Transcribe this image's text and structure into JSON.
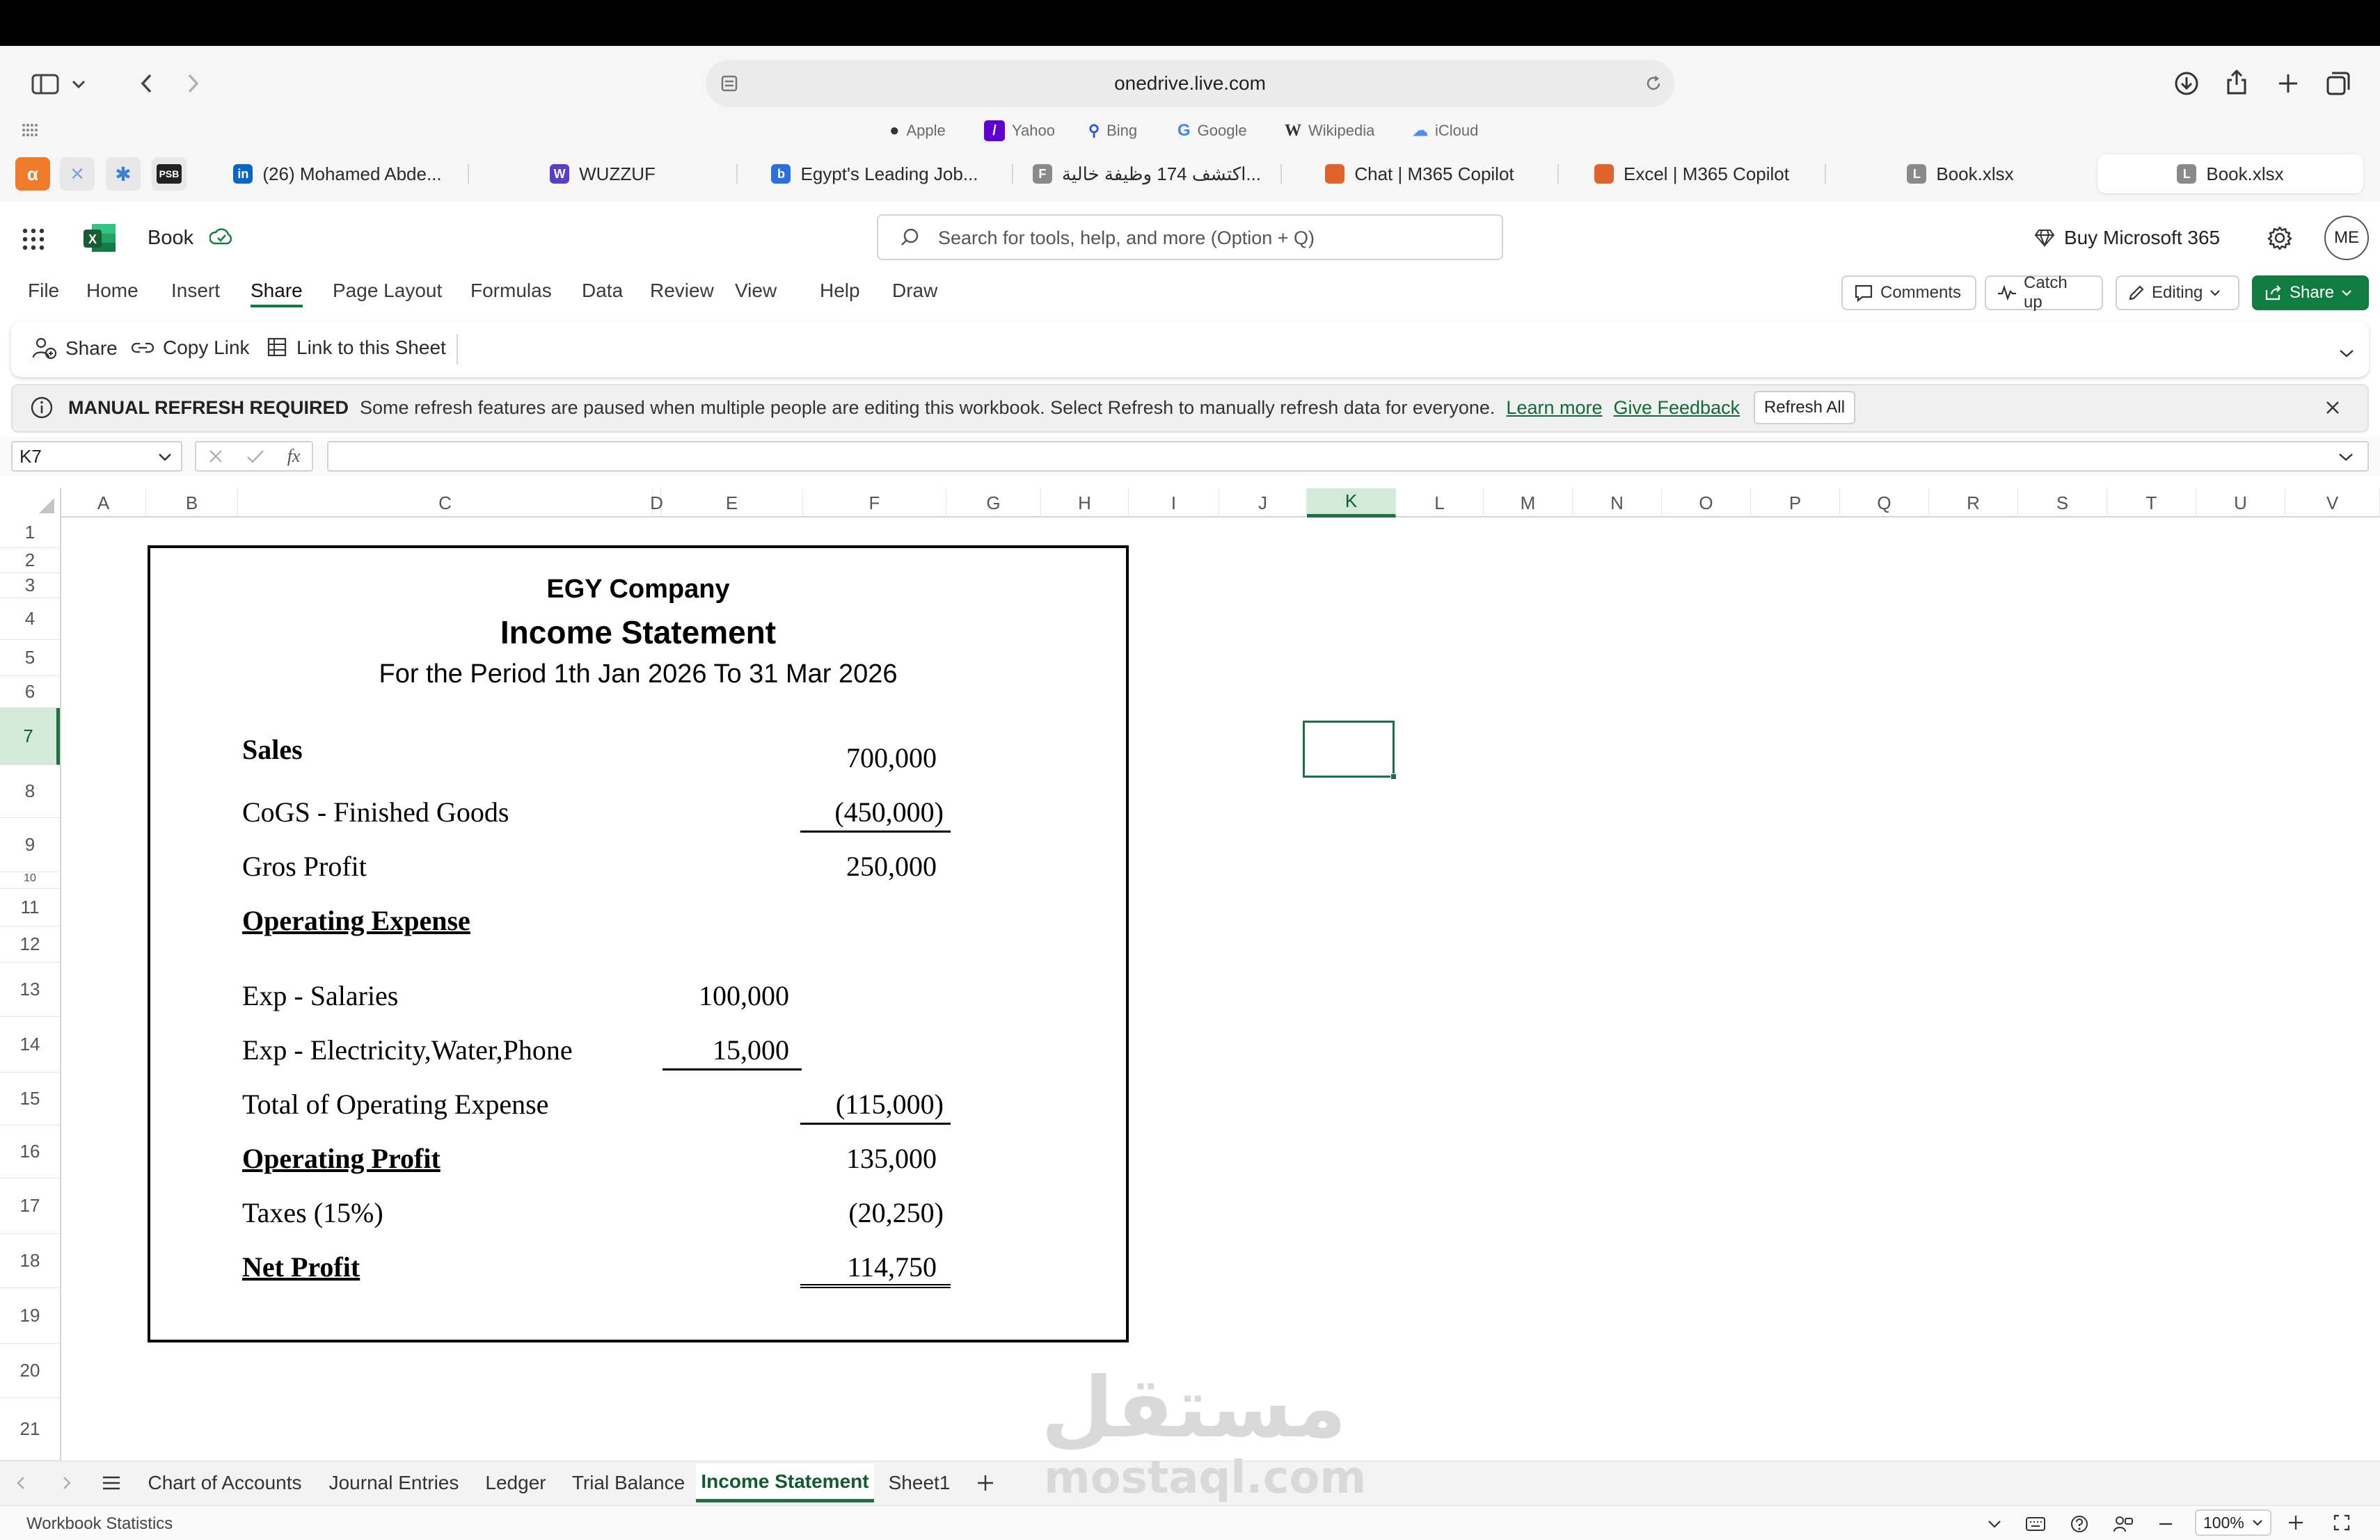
{
  "browser": {
    "address": "onedrive.live.com",
    "favorites": [
      {
        "label": "Apple",
        "icon": "apple-icon"
      },
      {
        "label": "Yahoo",
        "icon": "yahoo-icon"
      },
      {
        "label": "Bing",
        "icon": "bing-icon"
      },
      {
        "label": "Google",
        "icon": "google-icon"
      },
      {
        "label": "Wikipedia",
        "icon": "wikipedia-icon"
      },
      {
        "label": "iCloud",
        "icon": "icloud-icon"
      }
    ],
    "tabs": [
      {
        "label": "(26) Mohamed Abde...",
        "badge": "in",
        "color": "#0a66c2"
      },
      {
        "label": "WUZZUF",
        "badge": "W",
        "color": "#5a3ec8"
      },
      {
        "label": "Egypt's Leading Job...",
        "badge": "b",
        "color": "#2a6fdb"
      },
      {
        "label": "اكتشف 174 وظيفة خالية...",
        "badge": "F",
        "color": "#8a8a8a"
      },
      {
        "label": "Chat | M365 Copilot",
        "badge": "",
        "color": "#e0632b"
      },
      {
        "label": "Excel | M365 Copilot",
        "badge": "",
        "color": "#e0632b"
      },
      {
        "label": "Book.xlsx",
        "badge": "L",
        "color": "#8a8a8a"
      },
      {
        "label": "Book.xlsx",
        "badge": "L",
        "color": "#8a8a8a"
      }
    ]
  },
  "app": {
    "doc_title": "Book",
    "search_placeholder": "Search for tools, help, and more (Option + Q)",
    "buy_label": "Buy Microsoft 365",
    "avatar": "ME",
    "menus": [
      "File",
      "Home",
      "Insert",
      "Share",
      "Page Layout",
      "Formulas",
      "Data",
      "Review",
      "View",
      "Help",
      "Draw"
    ],
    "active_menu": "Share",
    "buttons": {
      "comments": "Comments",
      "catchup": "Catch up",
      "editing": "Editing",
      "share": "Share"
    },
    "ribbon": {
      "share": "Share",
      "copy_link": "Copy Link",
      "link_sheet": "Link to this Sheet"
    },
    "notice": {
      "title": "MANUAL REFRESH REQUIRED",
      "text": "Some refresh features are paused when multiple people are editing this workbook. Select Refresh to manually refresh data for everyone.",
      "learn": "Learn more",
      "feedback": "Give Feedback",
      "refresh": "Refresh All"
    },
    "name_box": "K7",
    "fx": "fx"
  },
  "grid": {
    "columns": [
      "A",
      "B",
      "C",
      "D",
      "E",
      "F",
      "G",
      "H",
      "I",
      "J",
      "K",
      "L",
      "M",
      "N",
      "O",
      "P",
      "Q",
      "R",
      "S",
      "T",
      "U",
      "V"
    ],
    "rows": [
      "1",
      "2",
      "3",
      "4",
      "5",
      "6",
      "7",
      "8",
      "9",
      "10",
      "11",
      "12",
      "13",
      "14",
      "15",
      "16",
      "17",
      "18",
      "19",
      "20",
      "21"
    ],
    "selected_cell": "K7"
  },
  "statement": {
    "company": "EGY Company",
    "title": "Income Statement",
    "period": "For the Period 1th Jan 2026 To 31 Mar 2026",
    "sales_label": "Sales",
    "sales_value": "700,000",
    "cogs_label": "CoGS - Finished Goods",
    "cogs_value": "(450,000)",
    "gross_label": "Gros Profit",
    "gross_value": "250,000",
    "opex_heading": "Operating Expense",
    "salaries_label": "Exp - Salaries",
    "salaries_value": "100,000",
    "utilities_label": "Exp - Electricity,Water,Phone",
    "utilities_value": "15,000",
    "total_opex_label": "Total of Operating Expense",
    "total_opex_value": "(115,000)",
    "op_profit_label": "Operating Profit",
    "op_profit_value": "135,000",
    "taxes_label": "Taxes (15%)",
    "taxes_value": "(20,250)",
    "net_label": "Net Profit",
    "net_value": "114,750"
  },
  "sheets": [
    "Chart of Accounts",
    "Journal Entries",
    "Ledger",
    "Trial Balance",
    "Income Statement",
    "Sheet1"
  ],
  "active_sheet": "Income Statement",
  "status": {
    "left": "Workbook Statistics",
    "zoom": "100%"
  },
  "watermark": {
    "arabic": "مستقل",
    "latin": "mostaql.com"
  },
  "colors": {
    "excel_green": "#107c41",
    "link_green": "#0e6b38",
    "selection": "#1e7145"
  }
}
